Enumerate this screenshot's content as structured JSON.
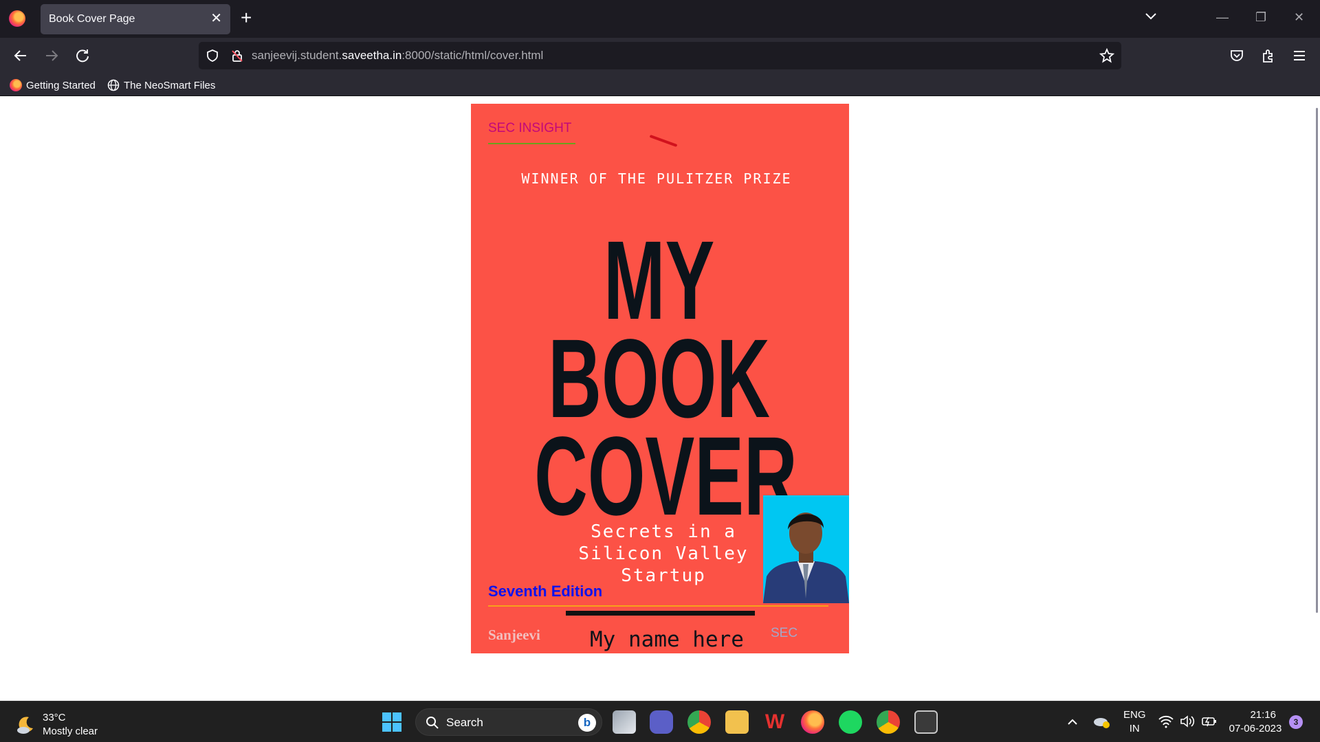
{
  "browser": {
    "tab_title": "Book Cover Page",
    "url_prefix": "sanjeevij.student.",
    "url_host": "saveetha.in",
    "url_suffix": ":8000/static/html/cover.html",
    "bookmarks": [
      {
        "label": "Getting Started",
        "icon": "firefox-icon"
      },
      {
        "label": "The NeoSmart Files",
        "icon": "globe-icon"
      }
    ]
  },
  "cover": {
    "brand": "SEC INSIGHT",
    "award": "WINNER OF THE PULITZER PRIZE",
    "title_lines": [
      "MY",
      "BOOK",
      "COVER"
    ],
    "subtitle_lines": [
      "Secrets in a",
      "Silicon Valley",
      "Startup"
    ],
    "edition": "Seventh Edition",
    "author": "Sanjeevi",
    "name_placeholder": "My name here",
    "publisher": "SEC",
    "colors": {
      "background": "#fc5246",
      "title": "#0b131a",
      "brand": "#c2087a",
      "edition": "#0a12ee"
    }
  },
  "taskbar": {
    "weather_temp": "33°C",
    "weather_desc": "Mostly clear",
    "search_label": "Search",
    "language_top": "ENG",
    "language_bottom": "IN",
    "time": "21:16",
    "date": "07-06-2023",
    "notification_count": "3"
  }
}
